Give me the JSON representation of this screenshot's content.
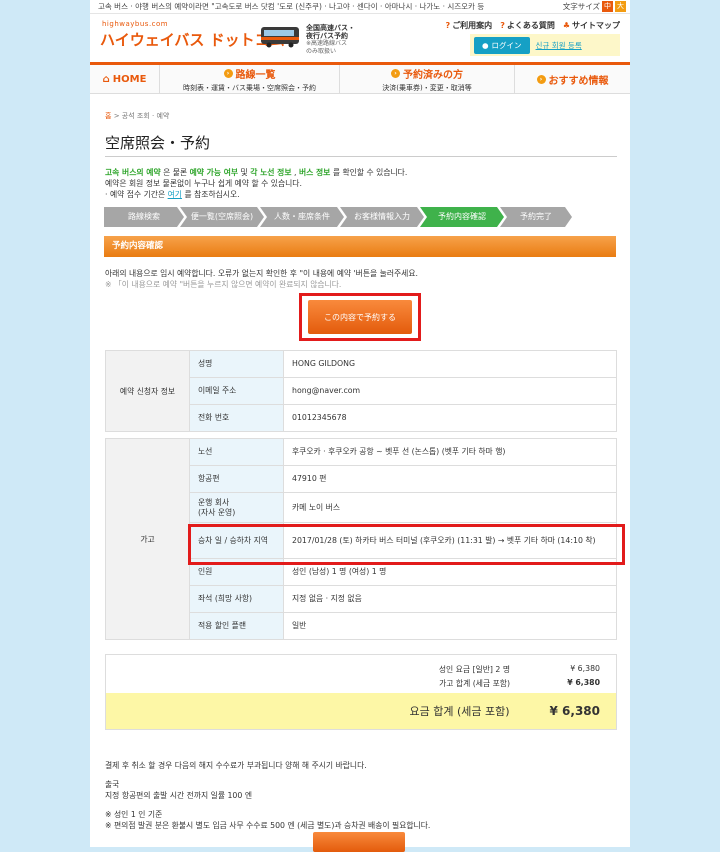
{
  "topbar": {
    "notice": "고속 버스 · 야행 버스의 예약이라면 \"고속도로 버스 닷컴 '도로 (신주쿠) · 나고야 · 센다이 · 아마나시 · 나가노 · 시즈오카 등",
    "font_size_label": "文字サイズ",
    "font_mid": "中",
    "font_large": "大"
  },
  "header": {
    "domain": "highwaybus.com",
    "logo": "ハイウェイバス ドットコム",
    "tagline_1": "全国高速バス・",
    "tagline_2": "夜行バス予約",
    "tagline_3": "※高速路線バス",
    "tagline_4": "のみ取扱い",
    "util_links": [
      {
        "icon": "?",
        "label": "ご利用案内"
      },
      {
        "icon": "?",
        "label": "よくある質問"
      },
      {
        "icon": "♣",
        "label": "サイトマップ"
      }
    ],
    "login_label": "ログイン",
    "register_label": "신규 회원 등록"
  },
  "nav": {
    "home": "HOME",
    "items": [
      {
        "title": "路線一覧",
        "sub": "時刻表・運賃・バス乗場・空席照会・予約"
      },
      {
        "title": "予約済みの方",
        "sub": "決済(乗車券)・変更・取消等"
      },
      {
        "title": "おすすめ情報",
        "sub": ""
      }
    ]
  },
  "breadcrumb": {
    "home": "홈",
    "sep": ">",
    "current": "공석 조회 · 예약"
  },
  "page_title": "空席照会・予約",
  "intro": {
    "l1_a": "고속 버스의 예약",
    "l1_b": " 은 물론 ",
    "l1_c": "예약 가능 여부",
    "l1_d": " 및 ",
    "l1_e": "각 노선 정보",
    "l1_f": " , ",
    "l1_g": "버스 정보",
    "l1_h": " 를 확인할 수 있습니다.",
    "l2": "예약은 회원 정보 물론없이 누구나 쉽게 예약 할 수 있습니다.",
    "l3_a": "· 예약 접수 기간은 ",
    "l3_link": "여기",
    "l3_b": " 를 참조하십시오."
  },
  "steps": [
    "路線検索",
    "便一覧(空席照会)",
    "人数・座席条件",
    "お客様情報入力",
    "予約内容確認",
    "予約完了"
  ],
  "section_title": "予約内容確認",
  "notice": {
    "line1": "아래의 내용으로 임시 예약합니다. 오류가 없는지 확인한 후 \"이 내용에 예약 '버튼을 눌러주세요.",
    "line2": "※ 「이 내용으로 예약 \"버튼을 누르지 않으면 예약이 완료되지 않습니다."
  },
  "confirm_button": "この内容で予約する",
  "applicant": {
    "group": "예약 신청자 정보",
    "rows": [
      {
        "label": "성명",
        "value": "HONG GILDONG"
      },
      {
        "label": "이메일 주소",
        "value": "hong@naver.com"
      },
      {
        "label": "전화 번호",
        "value": "01012345678"
      }
    ]
  },
  "trip": {
    "group": "가고",
    "rows": [
      {
        "label": "노선",
        "value": "후쿠오카 · 후쿠오카 공항 ~ 벳푸 선 (논스톱) (벳푸 기타 하마 행)"
      },
      {
        "label": "항공편",
        "value": "47910 편"
      },
      {
        "label": "운행 회사\n(자사 운영)",
        "value": "카메 노이 버스"
      },
      {
        "label": "승차 일 / 승하차 지역",
        "value": "2017/01/28 (토) 하카타 버스 터미널 (후쿠오카) (11:31 발) → 벳푸 기타 하마 (14:10 착)"
      },
      {
        "label": "인원",
        "value": "성인 (남성) 1 명 (여성) 1 명"
      },
      {
        "label": "좌석 (희망 사항)",
        "value": "지정 없음 · 지정 없음"
      },
      {
        "label": "적용 할인 플랜",
        "value": "일반"
      }
    ]
  },
  "summary": {
    "fare_label": "성인 요금 [일반] 2 명",
    "fare_value": "¥ 6,380",
    "subtotal_label": "가고 합계 (세금 포함)",
    "subtotal_value": "¥ 6,380",
    "total_label": "요금 합계 (세금 포함)",
    "total_value": "¥ 6,380"
  },
  "footer": {
    "l1": "결제 후 취소 할 경우 다음의 해지 수수료가 부과됩니다 양해 해 주시기 바랍니다.",
    "l2": "출국",
    "l3": "지정 항공편의 출발 시간 전까지 일률 100 엔",
    "l4": "※ 성인 1 인 기준",
    "l5": "※ 편의점 발권 분은 환불시 별도 입금 사무 수수료 500 엔 (세금 별도)과 승차권 배송이 필요합니다."
  }
}
